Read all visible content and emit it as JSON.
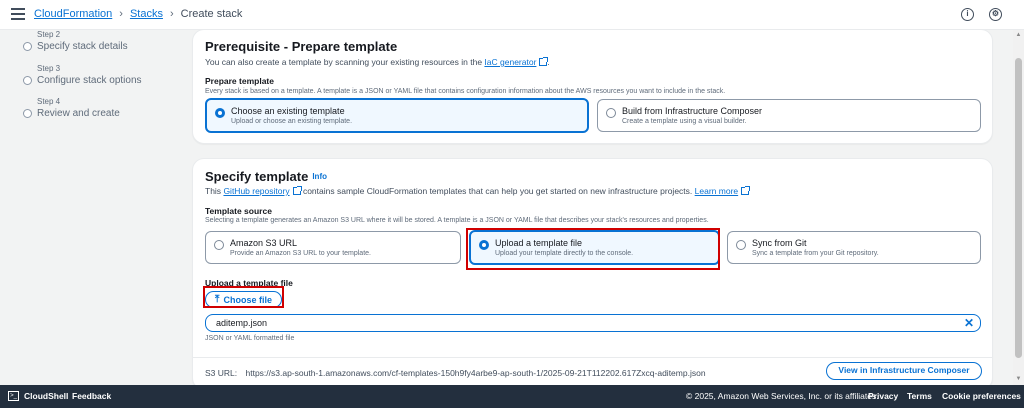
{
  "breadcrumb": {
    "items": [
      "CloudFormation",
      "Stacks"
    ],
    "current": "Create stack"
  },
  "steps": [
    {
      "num": "Step 2",
      "label": "Specify stack details"
    },
    {
      "num": "Step 3",
      "label": "Configure stack options"
    },
    {
      "num": "Step 4",
      "label": "Review and create"
    }
  ],
  "prereq": {
    "title": "Prerequisite - Prepare template",
    "desc_prefix": "You can also create a template by scanning your existing resources in the",
    "desc_link": "IaC generator",
    "desc_suffix": ".",
    "prepare_label": "Prepare template",
    "prepare_desc": "Every stack is based on a template. A template is a JSON or YAML file that contains configuration information about the AWS resources you want to include in the stack.",
    "options": [
      {
        "title": "Choose an existing template",
        "sub": "Upload or choose an existing template.",
        "selected": true
      },
      {
        "title": "Build from Infrastructure Composer",
        "sub": "Create a template using a visual builder.",
        "selected": false
      }
    ]
  },
  "specify": {
    "title": "Specify template",
    "info": "Info",
    "desc_prefix": "This",
    "desc_link1": "GitHub repository",
    "desc_middle": "contains sample CloudFormation templates that can help you get started on new infrastructure projects.",
    "desc_link2": "Learn more",
    "source_label": "Template source",
    "source_desc": "Selecting a template generates an Amazon S3 URL where it will be stored. A template is a JSON or YAML file that describes your stack's resources and properties.",
    "options": [
      {
        "title": "Amazon S3 URL",
        "sub": "Provide an Amazon S3 URL to your template.",
        "selected": false
      },
      {
        "title": "Upload a template file",
        "sub": "Upload your template directly to the console.",
        "selected": true
      },
      {
        "title": "Sync from Git",
        "sub": "Sync a template from your Git repository.",
        "selected": false
      }
    ],
    "upload_label": "Upload a template file",
    "choose_file": "Choose file",
    "file_name": "aditemp.json",
    "file_hint": "JSON or YAML formatted file",
    "s3_label": "S3 URL:",
    "s3_url": "https://s3.ap-south-1.amazonaws.com/cf-templates-150h9fy4arbe9-ap-south-1/2025-09-21T112202.617Zxcq-aditemp.json",
    "view_button": "View in Infrastructure Composer"
  },
  "footer": {
    "cloudshell": "CloudShell",
    "feedback": "Feedback",
    "copyright": "© 2025, Amazon Web Services, Inc. or its affiliates.",
    "privacy": "Privacy",
    "terms": "Terms",
    "cookies": "Cookie preferences"
  },
  "icons": {
    "menu": "hamburger-icon",
    "info": "info-circle-icon",
    "settings": "settings-icon",
    "upload": "upload-arrow-icon",
    "clear": "close-icon",
    "external": "external-link-icon"
  },
  "colors": {
    "accent": "#0972d3",
    "highlight": "#d00000",
    "footer_bg": "#232f3e"
  }
}
